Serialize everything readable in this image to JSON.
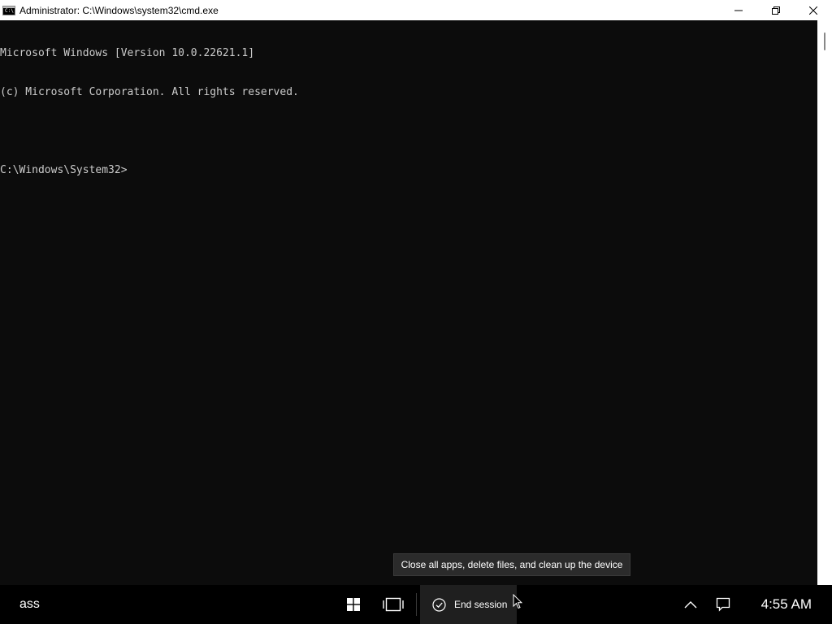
{
  "window": {
    "title": "Administrator: C:\\Windows\\system32\\cmd.exe",
    "icon_text": "C:\\"
  },
  "console": {
    "lines": [
      "Microsoft Windows [Version 10.0.22621.1]",
      "(c) Microsoft Corporation. All rights reserved.",
      "",
      "C:\\Windows\\System32>"
    ]
  },
  "tooltip": {
    "text": "Close all apps, delete files, and clean up the device"
  },
  "taskbar": {
    "left_text": "ass",
    "end_session_label": "End session",
    "clock": "4:55 AM"
  },
  "colors": {
    "console_bg": "#0c0c0c",
    "console_fg": "#cccccc",
    "taskbar_bg": "#000000",
    "titlebar_bg": "#ffffff"
  }
}
